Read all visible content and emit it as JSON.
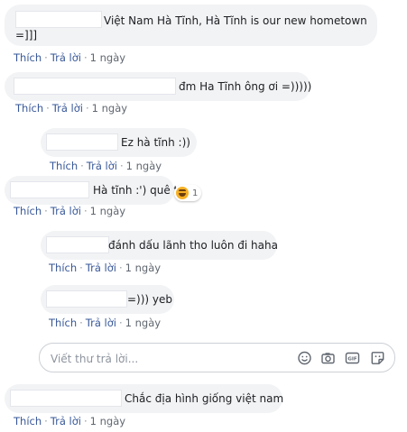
{
  "actions": {
    "like": "Thích",
    "reply": "Trả lời",
    "time": "1 ngày",
    "dot": "·"
  },
  "comments": [
    {
      "text": "Việt Nam Hà Tĩnh, Hà Tĩnh is our new hometown",
      "text2": "=]]]"
    },
    {
      "text": "đm Ha Tĩnh ông ơi =)))))"
    },
    {
      "text": "Ez hà tĩnh :))"
    },
    {
      "text": "Hà tĩnh :') quê t",
      "reaction_count": "1"
    },
    {
      "text": "đánh dấu lãnh tho luôn đi haha"
    },
    {
      "text": "=))) yeb"
    },
    {
      "text": "Chắc địa hình giống việt nam"
    }
  ],
  "reply_box": {
    "placeholder": "Viết thư trả lời..."
  },
  "colors": {
    "bubble": "#f2f3f5",
    "link": "#385898",
    "meta": "#606770"
  }
}
